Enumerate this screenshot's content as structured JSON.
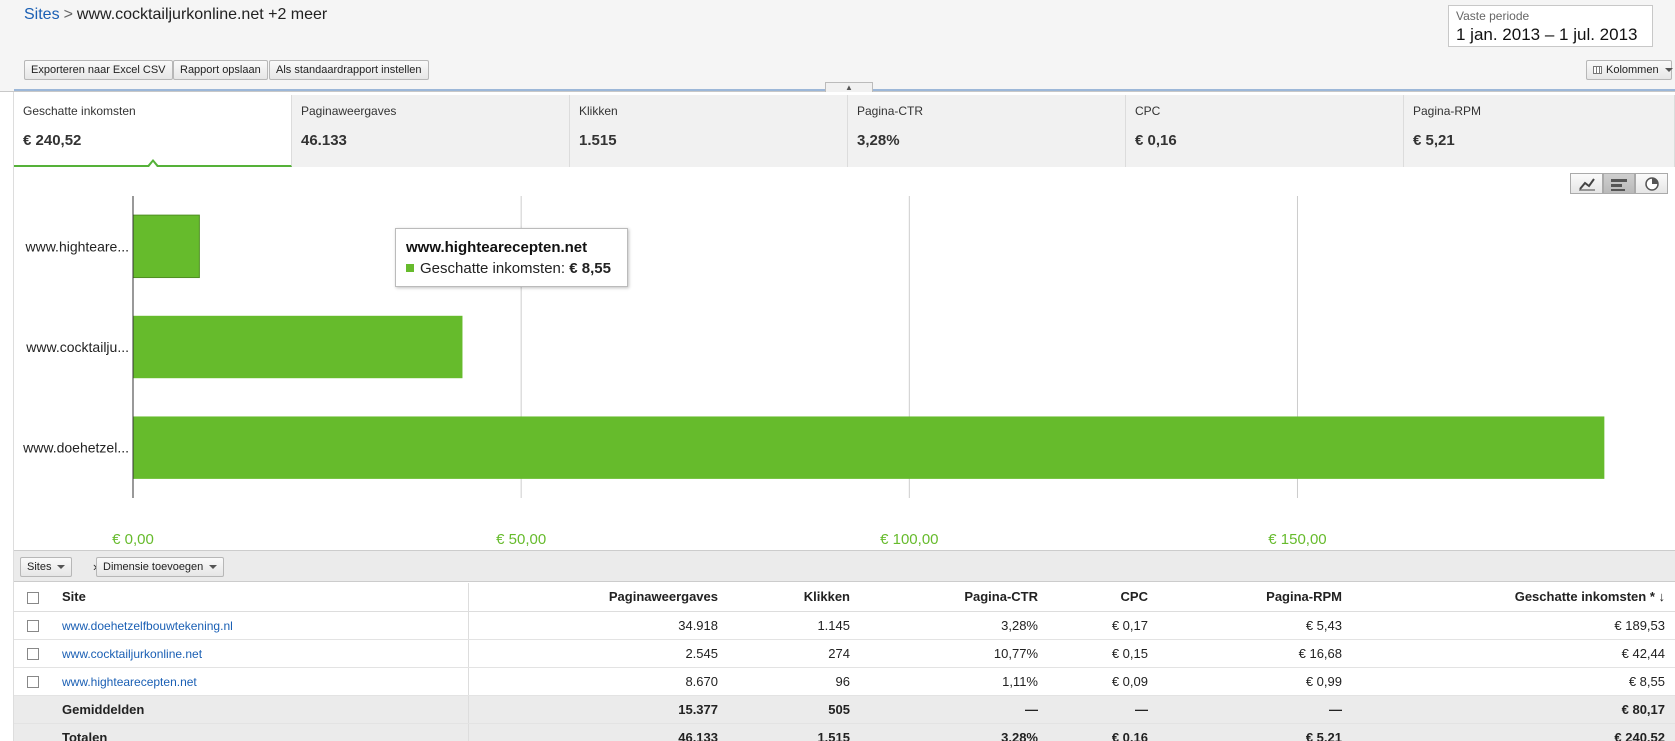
{
  "breadcrumb": {
    "root": "Sites",
    "separator": ">",
    "current": "www.cocktailjurkonline.net +2 meer"
  },
  "toolbar": {
    "export_label": "Exporteren naar Excel CSV",
    "save_label": "Rapport opslaan",
    "default_label": "Als standaardrapport instellen",
    "columns_label": "Kolommen"
  },
  "date_range": {
    "label": "Vaste periode",
    "value": "1 jan. 2013 – 1 jul. 2013"
  },
  "metrics": [
    {
      "label": "Geschatte inkomsten",
      "value": "€ 240,52"
    },
    {
      "label": "Paginaweergaves",
      "value": "46.133"
    },
    {
      "label": "Klikken",
      "value": "1.515"
    },
    {
      "label": "Pagina-CTR",
      "value": "3,28%"
    },
    {
      "label": "CPC",
      "value": "€ 0,16"
    },
    {
      "label": "Pagina-RPM",
      "value": "€ 5,21"
    }
  ],
  "view_icons": [
    "line-chart-icon",
    "bar-chart-icon",
    "pie-chart-icon"
  ],
  "chart_data": {
    "type": "bar",
    "orientation": "horizontal",
    "categories": [
      "www.highteare...",
      "www.cocktailju...",
      "www.doehetzel..."
    ],
    "values": [
      8.55,
      42.44,
      189.53
    ],
    "xlim": [
      0,
      190
    ],
    "xticks": [
      0,
      50,
      100,
      150
    ],
    "xtick_labels": [
      "€ 0,00",
      "€ 50,00",
      "€ 100,00",
      "€ 150,00"
    ],
    "grid": true,
    "bar_color": "#66bb2c",
    "tick_color": "#66bb2c"
  },
  "tooltip": {
    "title": "www.hightearecepten.net",
    "metric_label": "Geschatte inkomsten:",
    "metric_value": "€ 8,55"
  },
  "dimension_bar": {
    "sites_label": "Sites",
    "separator": "»",
    "add_dimension_label": "Dimensie toevoegen"
  },
  "table": {
    "headers": {
      "site": "Site",
      "pageviews": "Paginaweergaves",
      "clicks": "Klikken",
      "ctr": "Pagina-CTR",
      "cpc": "CPC",
      "rpm": "Pagina-RPM",
      "earnings": "Geschatte inkomsten * ↓"
    },
    "rows": [
      {
        "site": "www.doehetzelfbouwtekening.nl",
        "pageviews": "34.918",
        "clicks": "1.145",
        "ctr": "3,28%",
        "cpc": "€ 0,17",
        "rpm": "€ 5,43",
        "earnings": "€ 189,53"
      },
      {
        "site": "www.cocktailjurkonline.net",
        "pageviews": "2.545",
        "clicks": "274",
        "ctr": "10,77%",
        "cpc": "€ 0,15",
        "rpm": "€ 16,68",
        "earnings": "€ 42,44"
      },
      {
        "site": "www.hightearecepten.net",
        "pageviews": "8.670",
        "clicks": "96",
        "ctr": "1,11%",
        "cpc": "€ 0,09",
        "rpm": "€ 0,99",
        "earnings": "€ 8,55"
      }
    ],
    "averages": {
      "label": "Gemiddelden",
      "pageviews": "15.377",
      "clicks": "505",
      "ctr": "—",
      "cpc": "—",
      "rpm": "—",
      "earnings": "€ 80,17"
    },
    "totals": {
      "label": "Totalen",
      "pageviews": "46.133",
      "clicks": "1.515",
      "ctr": "3,28%",
      "cpc": "€ 0,16",
      "rpm": "€ 5,21",
      "earnings": "€ 240,52"
    }
  }
}
